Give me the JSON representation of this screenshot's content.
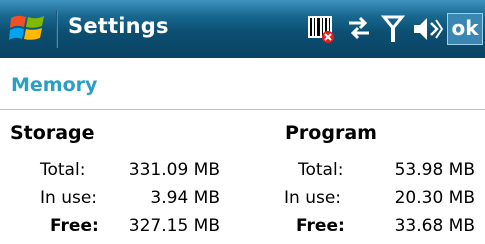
{
  "titlebar": {
    "title": "Settings",
    "ok_label": "ok"
  },
  "section": {
    "title": "Memory"
  },
  "storage": {
    "heading": "Storage",
    "total_label": "Total:",
    "total_value": "331.09 MB",
    "inuse_label": "In use:",
    "inuse_value": "3.94 MB",
    "free_label": "Free:",
    "free_value": "327.15 MB"
  },
  "program": {
    "heading": "Program",
    "total_label": "Total:",
    "total_value": "53.98 MB",
    "inuse_label": "In use:",
    "inuse_value": "20.30 MB",
    "free_label": "Free:",
    "free_value": "33.68 MB"
  },
  "icons": {
    "start": "windows-flag-icon",
    "barcode": "barcode-disabled-icon",
    "connectivity": "connectivity-arrows-icon",
    "signal": "signal-antenna-icon",
    "volume": "volume-muted-icon"
  },
  "colors": {
    "titlebar": "#17678f",
    "section_header": "#2a9ec4"
  }
}
